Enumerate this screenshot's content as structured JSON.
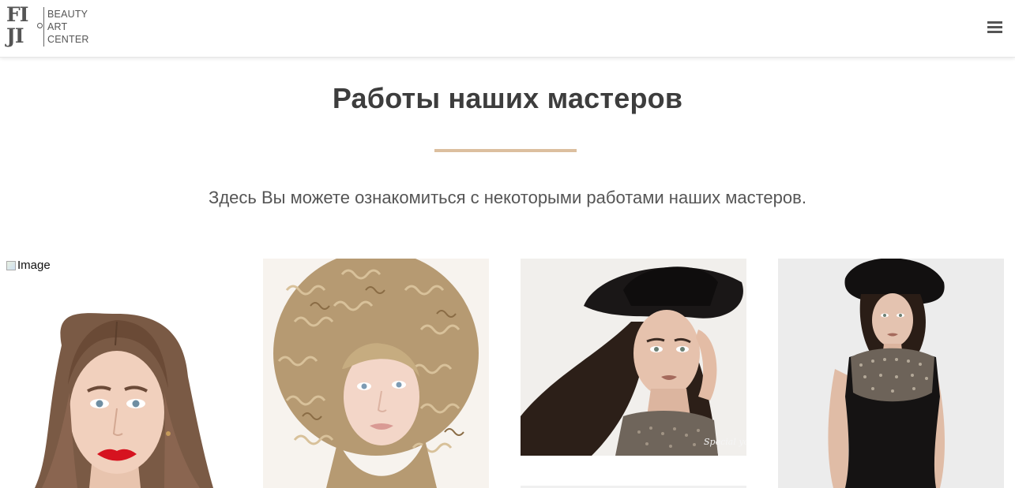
{
  "header": {
    "logo": {
      "mark_row1": "FI",
      "mark_row2": "JI",
      "text_lines": [
        "BEAUTY",
        "ART",
        "CENTER"
      ]
    },
    "menu_icon": "hamburger-menu-icon"
  },
  "main": {
    "title": "Работы наших мастеров",
    "subtitle": "Здесь Вы можете ознакомиться с некоторыми работами наших мастеров.",
    "accent_color": "#dcbf9f"
  },
  "gallery": {
    "items": [
      {
        "alt": "Image"
      },
      {
        "alt": ""
      },
      {
        "alt": "",
        "signature": "Special you"
      },
      {
        "alt": ""
      }
    ]
  }
}
